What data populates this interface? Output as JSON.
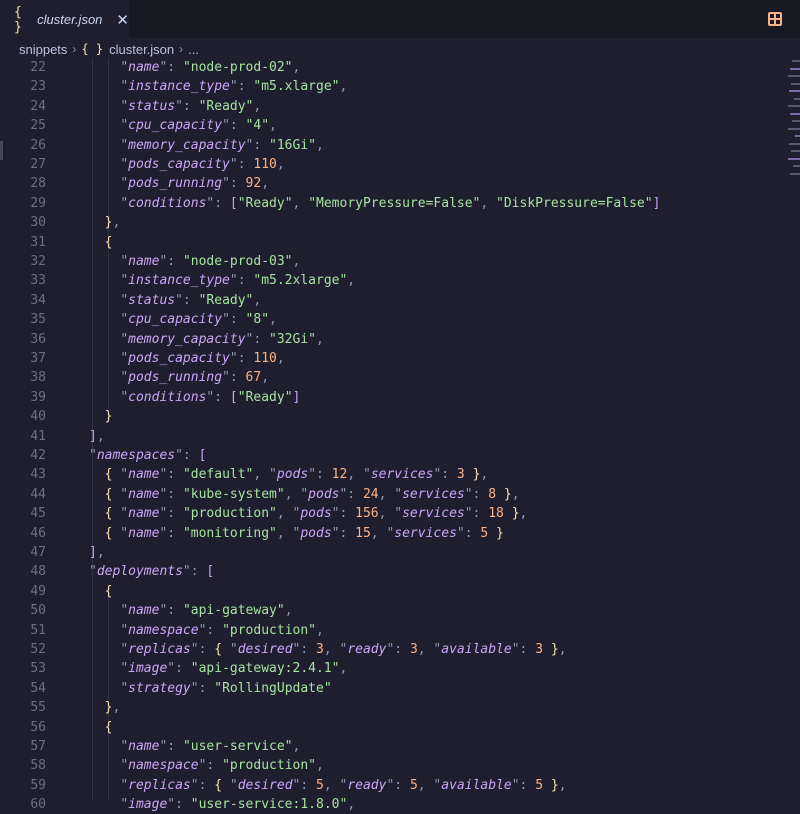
{
  "tab": {
    "icon": "{ }",
    "title": "cluster.json",
    "close": "✕"
  },
  "breadcrumb": {
    "folder": "snippets",
    "file_icon": "{ }",
    "file": "cluster.json",
    "ellipsis": "...",
    "separator": "›"
  },
  "colors": {
    "key": "#cba6f7",
    "string": "#a6e3a1",
    "number": "#fab387",
    "punctuation": "#9399b2",
    "bracket": "#f9e2af",
    "background": "#1e1e2e"
  },
  "lines": [
    {
      "n": "22",
      "t": [
        [
          "    ",
          "p"
        ],
        [
          "\"",
          "p"
        ],
        [
          "name",
          "k"
        ],
        [
          "\": ",
          "p"
        ],
        [
          "\"node-prod-02\"",
          "s"
        ],
        [
          ",",
          "p"
        ]
      ]
    },
    {
      "n": "23",
      "t": [
        [
          "    ",
          "p"
        ],
        [
          "\"",
          "p"
        ],
        [
          "instance_type",
          "k"
        ],
        [
          "\": ",
          "p"
        ],
        [
          "\"m5.xlarge\"",
          "s"
        ],
        [
          ",",
          "p"
        ]
      ]
    },
    {
      "n": "24",
      "t": [
        [
          "    ",
          "p"
        ],
        [
          "\"",
          "p"
        ],
        [
          "status",
          "k"
        ],
        [
          "\": ",
          "p"
        ],
        [
          "\"Ready\"",
          "s"
        ],
        [
          ",",
          "p"
        ]
      ]
    },
    {
      "n": "25",
      "t": [
        [
          "    ",
          "p"
        ],
        [
          "\"",
          "p"
        ],
        [
          "cpu_capacity",
          "k"
        ],
        [
          "\": ",
          "p"
        ],
        [
          "\"4\"",
          "s"
        ],
        [
          ",",
          "p"
        ]
      ]
    },
    {
      "n": "26",
      "t": [
        [
          "    ",
          "p"
        ],
        [
          "\"",
          "p"
        ],
        [
          "memory_capacity",
          "k"
        ],
        [
          "\": ",
          "p"
        ],
        [
          "\"16Gi\"",
          "s"
        ],
        [
          ",",
          "p"
        ]
      ]
    },
    {
      "n": "27",
      "t": [
        [
          "    ",
          "p"
        ],
        [
          "\"",
          "p"
        ],
        [
          "pods_capacity",
          "k"
        ],
        [
          "\": ",
          "p"
        ],
        [
          "110",
          "n"
        ],
        [
          ",",
          "p"
        ]
      ]
    },
    {
      "n": "28",
      "t": [
        [
          "    ",
          "p"
        ],
        [
          "\"",
          "p"
        ],
        [
          "pods_running",
          "k"
        ],
        [
          "\": ",
          "p"
        ],
        [
          "92",
          "n"
        ],
        [
          ",",
          "p"
        ]
      ]
    },
    {
      "n": "29",
      "t": [
        [
          "    ",
          "p"
        ],
        [
          "\"",
          "p"
        ],
        [
          "conditions",
          "k"
        ],
        [
          "\": ",
          "p"
        ],
        [
          "[",
          "b2"
        ],
        [
          "\"Ready\"",
          "s"
        ],
        [
          ", ",
          "p"
        ],
        [
          "\"MemoryPressure=False\"",
          "s"
        ],
        [
          ", ",
          "p"
        ],
        [
          "\"DiskPressure=False\"",
          "s"
        ],
        [
          "]",
          "b2"
        ]
      ]
    },
    {
      "n": "30",
      "t": [
        [
          "  ",
          "p"
        ],
        [
          "}",
          "b1"
        ],
        [
          ",",
          "p"
        ]
      ]
    },
    {
      "n": "31",
      "t": [
        [
          "  ",
          "p"
        ],
        [
          "{",
          "b1"
        ]
      ]
    },
    {
      "n": "32",
      "t": [
        [
          "    ",
          "p"
        ],
        [
          "\"",
          "p"
        ],
        [
          "name",
          "k"
        ],
        [
          "\": ",
          "p"
        ],
        [
          "\"node-prod-03\"",
          "s"
        ],
        [
          ",",
          "p"
        ]
      ]
    },
    {
      "n": "33",
      "t": [
        [
          "    ",
          "p"
        ],
        [
          "\"",
          "p"
        ],
        [
          "instance_type",
          "k"
        ],
        [
          "\": ",
          "p"
        ],
        [
          "\"m5.2xlarge\"",
          "s"
        ],
        [
          ",",
          "p"
        ]
      ]
    },
    {
      "n": "34",
      "t": [
        [
          "    ",
          "p"
        ],
        [
          "\"",
          "p"
        ],
        [
          "status",
          "k"
        ],
        [
          "\": ",
          "p"
        ],
        [
          "\"Ready\"",
          "s"
        ],
        [
          ",",
          "p"
        ]
      ]
    },
    {
      "n": "35",
      "t": [
        [
          "    ",
          "p"
        ],
        [
          "\"",
          "p"
        ],
        [
          "cpu_capacity",
          "k"
        ],
        [
          "\": ",
          "p"
        ],
        [
          "\"8\"",
          "s"
        ],
        [
          ",",
          "p"
        ]
      ]
    },
    {
      "n": "36",
      "t": [
        [
          "    ",
          "p"
        ],
        [
          "\"",
          "p"
        ],
        [
          "memory_capacity",
          "k"
        ],
        [
          "\": ",
          "p"
        ],
        [
          "\"32Gi\"",
          "s"
        ],
        [
          ",",
          "p"
        ]
      ]
    },
    {
      "n": "37",
      "t": [
        [
          "    ",
          "p"
        ],
        [
          "\"",
          "p"
        ],
        [
          "pods_capacity",
          "k"
        ],
        [
          "\": ",
          "p"
        ],
        [
          "110",
          "n"
        ],
        [
          ",",
          "p"
        ]
      ]
    },
    {
      "n": "38",
      "t": [
        [
          "    ",
          "p"
        ],
        [
          "\"",
          "p"
        ],
        [
          "pods_running",
          "k"
        ],
        [
          "\": ",
          "p"
        ],
        [
          "67",
          "n"
        ],
        [
          ",",
          "p"
        ]
      ]
    },
    {
      "n": "39",
      "t": [
        [
          "    ",
          "p"
        ],
        [
          "\"",
          "p"
        ],
        [
          "conditions",
          "k"
        ],
        [
          "\": ",
          "p"
        ],
        [
          "[",
          "b2"
        ],
        [
          "\"Ready\"",
          "s"
        ],
        [
          "]",
          "b2"
        ]
      ]
    },
    {
      "n": "40",
      "t": [
        [
          "  ",
          "p"
        ],
        [
          "}",
          "b1"
        ]
      ]
    },
    {
      "n": "41",
      "t": [
        [
          "",
          "p"
        ],
        [
          "]",
          "b2"
        ],
        [
          ",",
          "p"
        ]
      ]
    },
    {
      "n": "42",
      "t": [
        [
          "",
          "p"
        ],
        [
          "\"",
          "p"
        ],
        [
          "namespaces",
          "k"
        ],
        [
          "\": ",
          "p"
        ],
        [
          "[",
          "b2"
        ]
      ]
    },
    {
      "n": "43",
      "t": [
        [
          "  ",
          "p"
        ],
        [
          "{",
          "b1"
        ],
        [
          " \"",
          "p"
        ],
        [
          "name",
          "k"
        ],
        [
          "\": ",
          "p"
        ],
        [
          "\"default\"",
          "s"
        ],
        [
          ", \"",
          "p"
        ],
        [
          "pods",
          "k"
        ],
        [
          "\": ",
          "p"
        ],
        [
          "12",
          "n"
        ],
        [
          ", \"",
          "p"
        ],
        [
          "services",
          "k"
        ],
        [
          "\": ",
          "p"
        ],
        [
          "3",
          "n"
        ],
        [
          " ",
          "p"
        ],
        [
          "}",
          "b1"
        ],
        [
          ",",
          "p"
        ]
      ]
    },
    {
      "n": "44",
      "t": [
        [
          "  ",
          "p"
        ],
        [
          "{",
          "b1"
        ],
        [
          " \"",
          "p"
        ],
        [
          "name",
          "k"
        ],
        [
          "\": ",
          "p"
        ],
        [
          "\"kube-system\"",
          "s"
        ],
        [
          ", \"",
          "p"
        ],
        [
          "pods",
          "k"
        ],
        [
          "\": ",
          "p"
        ],
        [
          "24",
          "n"
        ],
        [
          ", \"",
          "p"
        ],
        [
          "services",
          "k"
        ],
        [
          "\": ",
          "p"
        ],
        [
          "8",
          "n"
        ],
        [
          " ",
          "p"
        ],
        [
          "}",
          "b1"
        ],
        [
          ",",
          "p"
        ]
      ]
    },
    {
      "n": "45",
      "t": [
        [
          "  ",
          "p"
        ],
        [
          "{",
          "b1"
        ],
        [
          " \"",
          "p"
        ],
        [
          "name",
          "k"
        ],
        [
          "\": ",
          "p"
        ],
        [
          "\"production\"",
          "s"
        ],
        [
          ", \"",
          "p"
        ],
        [
          "pods",
          "k"
        ],
        [
          "\": ",
          "p"
        ],
        [
          "156",
          "n"
        ],
        [
          ", \"",
          "p"
        ],
        [
          "services",
          "k"
        ],
        [
          "\": ",
          "p"
        ],
        [
          "18",
          "n"
        ],
        [
          " ",
          "p"
        ],
        [
          "}",
          "b1"
        ],
        [
          ",",
          "p"
        ]
      ]
    },
    {
      "n": "46",
      "t": [
        [
          "  ",
          "p"
        ],
        [
          "{",
          "b1"
        ],
        [
          " \"",
          "p"
        ],
        [
          "name",
          "k"
        ],
        [
          "\": ",
          "p"
        ],
        [
          "\"monitoring\"",
          "s"
        ],
        [
          ", \"",
          "p"
        ],
        [
          "pods",
          "k"
        ],
        [
          "\": ",
          "p"
        ],
        [
          "15",
          "n"
        ],
        [
          ", \"",
          "p"
        ],
        [
          "services",
          "k"
        ],
        [
          "\": ",
          "p"
        ],
        [
          "5",
          "n"
        ],
        [
          " ",
          "p"
        ],
        [
          "}",
          "b1"
        ]
      ]
    },
    {
      "n": "47",
      "t": [
        [
          "",
          "p"
        ],
        [
          "]",
          "b2"
        ],
        [
          ",",
          "p"
        ]
      ]
    },
    {
      "n": "48",
      "t": [
        [
          "",
          "p"
        ],
        [
          "\"",
          "p"
        ],
        [
          "deployments",
          "k"
        ],
        [
          "\": ",
          "p"
        ],
        [
          "[",
          "b2"
        ]
      ]
    },
    {
      "n": "49",
      "t": [
        [
          "  ",
          "p"
        ],
        [
          "{",
          "b1"
        ]
      ]
    },
    {
      "n": "50",
      "t": [
        [
          "    ",
          "p"
        ],
        [
          "\"",
          "p"
        ],
        [
          "name",
          "k"
        ],
        [
          "\": ",
          "p"
        ],
        [
          "\"api-gateway\"",
          "s"
        ],
        [
          ",",
          "p"
        ]
      ]
    },
    {
      "n": "51",
      "t": [
        [
          "    ",
          "p"
        ],
        [
          "\"",
          "p"
        ],
        [
          "namespace",
          "k"
        ],
        [
          "\": ",
          "p"
        ],
        [
          "\"production\"",
          "s"
        ],
        [
          ",",
          "p"
        ]
      ]
    },
    {
      "n": "52",
      "t": [
        [
          "    ",
          "p"
        ],
        [
          "\"",
          "p"
        ],
        [
          "replicas",
          "k"
        ],
        [
          "\": ",
          "p"
        ],
        [
          "{",
          "b1"
        ],
        [
          " \"",
          "p"
        ],
        [
          "desired",
          "k"
        ],
        [
          "\": ",
          "p"
        ],
        [
          "3",
          "n"
        ],
        [
          ", \"",
          "p"
        ],
        [
          "ready",
          "k"
        ],
        [
          "\": ",
          "p"
        ],
        [
          "3",
          "n"
        ],
        [
          ", \"",
          "p"
        ],
        [
          "available",
          "k"
        ],
        [
          "\": ",
          "p"
        ],
        [
          "3",
          "n"
        ],
        [
          " ",
          "p"
        ],
        [
          "}",
          "b1"
        ],
        [
          ",",
          "p"
        ]
      ]
    },
    {
      "n": "53",
      "t": [
        [
          "    ",
          "p"
        ],
        [
          "\"",
          "p"
        ],
        [
          "image",
          "k"
        ],
        [
          "\": ",
          "p"
        ],
        [
          "\"api-gateway:2.4.1\"",
          "s"
        ],
        [
          ",",
          "p"
        ]
      ]
    },
    {
      "n": "54",
      "t": [
        [
          "    ",
          "p"
        ],
        [
          "\"",
          "p"
        ],
        [
          "strategy",
          "k"
        ],
        [
          "\": ",
          "p"
        ],
        [
          "\"RollingUpdate\"",
          "s"
        ]
      ]
    },
    {
      "n": "55",
      "t": [
        [
          "  ",
          "p"
        ],
        [
          "}",
          "b1"
        ],
        [
          ",",
          "p"
        ]
      ]
    },
    {
      "n": "56",
      "t": [
        [
          "  ",
          "p"
        ],
        [
          "{",
          "b1"
        ]
      ]
    },
    {
      "n": "57",
      "t": [
        [
          "    ",
          "p"
        ],
        [
          "\"",
          "p"
        ],
        [
          "name",
          "k"
        ],
        [
          "\": ",
          "p"
        ],
        [
          "\"user-service\"",
          "s"
        ],
        [
          ",",
          "p"
        ]
      ]
    },
    {
      "n": "58",
      "t": [
        [
          "    ",
          "p"
        ],
        [
          "\"",
          "p"
        ],
        [
          "namespace",
          "k"
        ],
        [
          "\": ",
          "p"
        ],
        [
          "\"production\"",
          "s"
        ],
        [
          ",",
          "p"
        ]
      ]
    },
    {
      "n": "59",
      "t": [
        [
          "    ",
          "p"
        ],
        [
          "\"",
          "p"
        ],
        [
          "replicas",
          "k"
        ],
        [
          "\": ",
          "p"
        ],
        [
          "{",
          "b1"
        ],
        [
          " \"",
          "p"
        ],
        [
          "desired",
          "k"
        ],
        [
          "\": ",
          "p"
        ],
        [
          "5",
          "n"
        ],
        [
          ", \"",
          "p"
        ],
        [
          "ready",
          "k"
        ],
        [
          "\": ",
          "p"
        ],
        [
          "5",
          "n"
        ],
        [
          ", \"",
          "p"
        ],
        [
          "available",
          "k"
        ],
        [
          "\": ",
          "p"
        ],
        [
          "5",
          "n"
        ],
        [
          " ",
          "p"
        ],
        [
          "}",
          "b1"
        ],
        [
          ",",
          "p"
        ]
      ]
    },
    {
      "n": "60",
      "t": [
        [
          "    ",
          "p"
        ],
        [
          "\"",
          "p"
        ],
        [
          "image",
          "k"
        ],
        [
          "\": ",
          "p"
        ],
        [
          "\"user-service:1.8.0\"",
          "s"
        ],
        [
          ",",
          "p"
        ]
      ]
    }
  ]
}
